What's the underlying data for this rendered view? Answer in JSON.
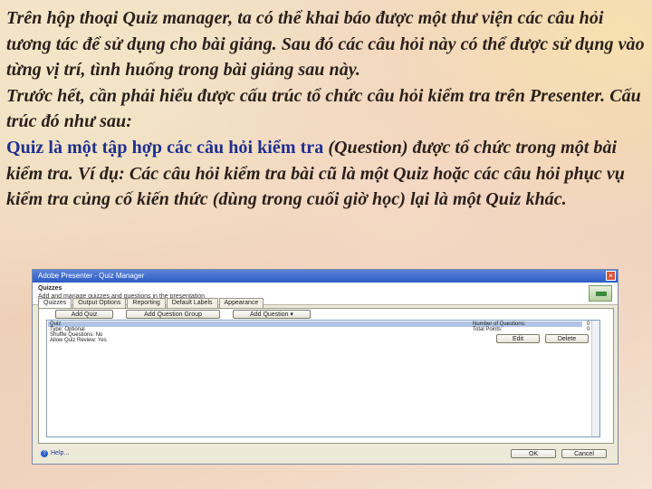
{
  "slide": {
    "p1": "Trên hộp thoại Quiz manager, ta có thể khai báo được một thư viện các câu hỏi tương tác để sử dụng cho bài giảng. Sau đó các câu hỏi này có thể được sử dụng vào từng vị trí, tình huống trong bài giảng sau này.",
    "p2": "Trước hết, cần phải hiểu được cấu trúc tổ chức câu hỏi kiểm tra trên Presenter. Cấu trúc đó như sau:",
    "p3_highlight": "Quiz là một tập hợp các câu hỏi kiểm tra",
    "p3_rest": " (Question) được tổ chức trong một bài kiểm tra. Ví dụ: Các câu hỏi kiểm tra bài cũ là một Quiz hoặc các câu hỏi phục vụ kiểm tra củng cố kiến thức (dùng trong cuối giờ học) lại là một Quiz khác."
  },
  "dialog": {
    "title": "Adobe Presenter - Quiz Manager",
    "close": "×",
    "header_title": "Quizzes",
    "header_desc": "Add and manage quizzes and questions in the presentation",
    "tabs": [
      "Quizzes",
      "Output Options",
      "Reporting",
      "Default Labels",
      "Appearance"
    ],
    "buttons": {
      "add_quiz": "Add Quiz",
      "add_question_group": "Add Question Group",
      "add_question": "Add Question",
      "edit": "Edit",
      "delete": "Delete",
      "ok": "OK",
      "cancel": "Cancel"
    },
    "list": {
      "lines": [
        "Quiz",
        "Type: Optional",
        "Shuffle Questions: No",
        "Allow Quiz Review: Yes"
      ],
      "right_labels": [
        "Number of Questions:",
        "Total Points:"
      ],
      "right_values": [
        "0",
        "0"
      ]
    },
    "help": "Help..."
  }
}
